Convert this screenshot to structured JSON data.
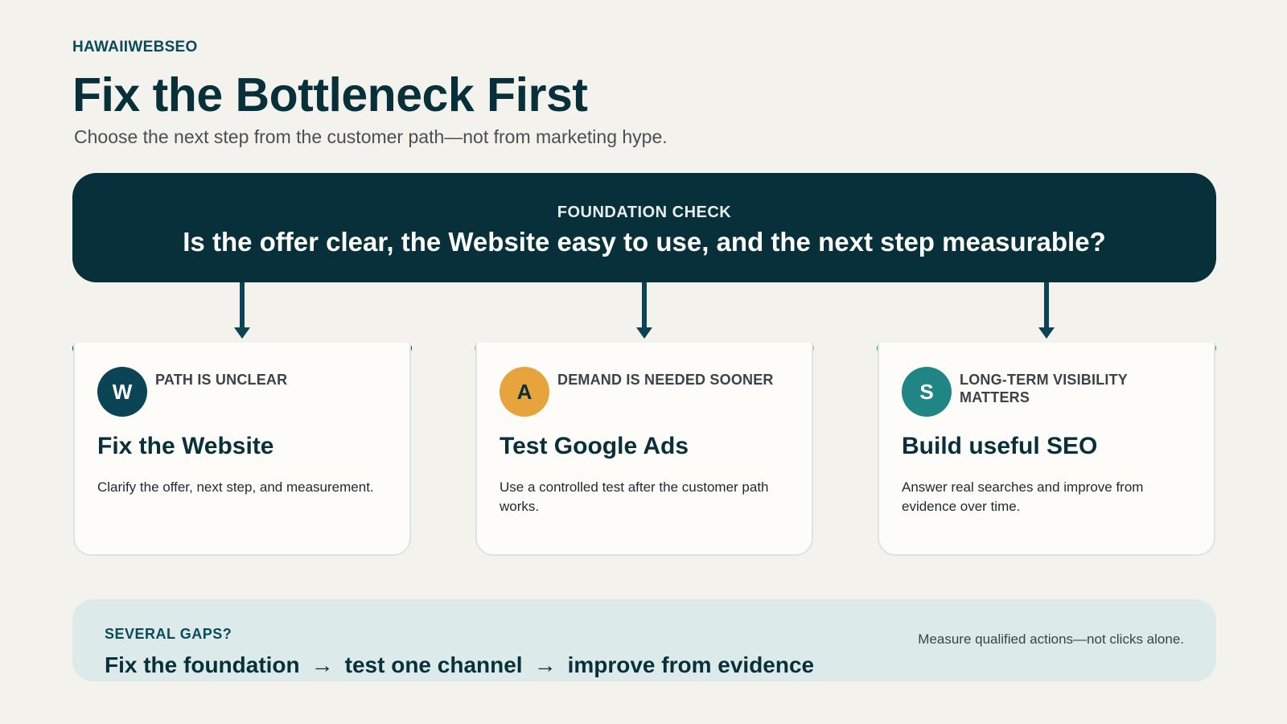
{
  "header": {
    "brand": "HAWAIIWEBSEO",
    "title": "Fix the Bottleneck First",
    "subtitle": "Choose the next step from the customer path—not from marketing hype."
  },
  "foundation": {
    "kicker": "FOUNDATION CHECK",
    "question": "Is the offer clear, the Website easy to use, and the next step measurable?"
  },
  "cards": [
    {
      "badge": "W",
      "condition": "PATH IS UNCLEAR",
      "title": "Fix the Website",
      "description": "Clarify the offer, next step, and measurement.",
      "accent": "#0b4455"
    },
    {
      "badge": "A",
      "condition": "DEMAND IS NEEDED SOONER",
      "title": "Test Google Ads",
      "description": "Use a controlled test after the customer path works.",
      "accent": "#e7a33c"
    },
    {
      "badge": "S",
      "condition": "LONG-TERM VISIBILITY MATTERS",
      "title": "Build useful SEO",
      "description": "Answer real searches and improve from evidence over time.",
      "accent": "#1f8585"
    }
  ],
  "gaps": {
    "kicker": "SEVERAL GAPS?",
    "steps": [
      "Fix the foundation",
      "test one channel",
      "improve from evidence"
    ],
    "arrow": "→",
    "note": "Measure qualified actions—not clicks alone."
  }
}
